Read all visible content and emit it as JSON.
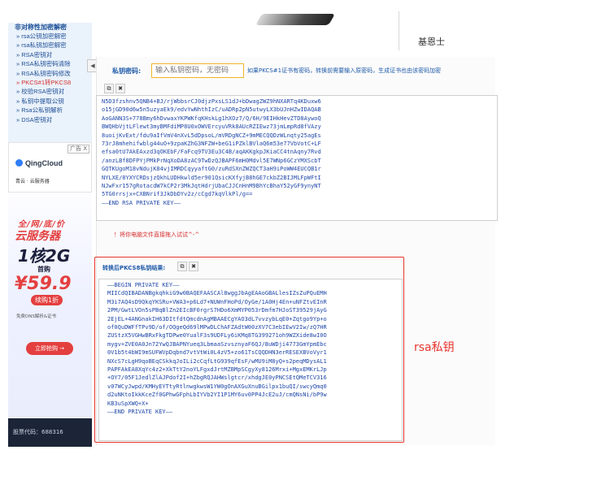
{
  "sidebar": {
    "title": "非对称性加密解密",
    "items": [
      {
        "label": "» rsa公钥加密解密",
        "active": false
      },
      {
        "label": "» rsa私钥加密解密",
        "active": false
      },
      {
        "label": "» RSA密钥对",
        "active": false
      },
      {
        "label": "» RSA私钥密码清除",
        "active": false
      },
      {
        "label": "» RSA私钥密码修改",
        "active": false
      },
      {
        "label": "» PKCS#1转PKCS8",
        "active": true
      },
      {
        "label": "» 校验RSA密钥对",
        "active": false
      },
      {
        "label": "» 私钥中提取公钥",
        "active": false
      },
      {
        "label": "» Rsa公私钥解析",
        "active": false
      },
      {
        "label": "» DSA密钥对",
        "active": false
      }
    ],
    "collapse_label": "◀"
  },
  "ad": {
    "close_label": "广告 X",
    "logo": "QingCloud",
    "sub": "青云 · 云服务器",
    "line1": "全/网/底/价",
    "line2": "云服务器",
    "line3": "1核2G",
    "line4": "首购",
    "line5": "¥59.9",
    "line6": "续购1折",
    "line7": "免费DNS解析&证书",
    "cta": "立即抢购 →",
    "stock": "股票代码：688316"
  },
  "top": {
    "right_text": "基恩士"
  },
  "form": {
    "password_label": "私钥密码:",
    "password_placeholder": "输入私钥密码，无密码",
    "password_note": "如果PKCS#1证书有密码，转换前需要输入原密码，生成证书也由该密码加密",
    "copy_icon": "⧉",
    "clear_icon": "✖",
    "input_key": "N5D3fzshnv5QNB4+BJ/rjWbbsrCJ0djzPxsLS1dJ+bDwagZWZ9hNXARTq4KDuxw6\no15jGD90d6w5n5uzyaEk9/edvYwNhthIzC/uADRp2pN5utwyLX3bUJnHZwIDAQAB\nAoGANN3S+778Bmy6hDvwaxYKPWKfqKHskLg1hXOz7/Q/6H/9EIHkHevZTD8AywoQ\nBWQHbVjtLFlewt3myBMFdiMP8U0xOWVErcyuVRk8AUcRZIEwz73jmLmpRd8fVAzy\n8uoijKvExt/fdu9aIfVmV4nXvL5dDpsoL/mVRDgNCZ+9mMECQQDzWLnqty25agEs\n73rJ8mhehifwblg44uO+9zpaKZhG3NFZW+beG1iPZklBVlaQ6m53e77VbVotC+LF\nefsa0tU7AkEAxzd3qOKEbF/FaFcq9TV3Eu3C4B/aqAKKgkpJKiaCC4tnAqny7Rvd\n/anzLBf8DFPYjPMkPrNqXoDA8zAC9TwDzQJBAPF6mH0Mdvl5E7WNp6GCzYMXScbT\nGQTKUgoM18vNdujK84vjIMRDCqyyaftG0/zuRdSXnZWZQCT3aH9iPoWW4EUCQB1r\nNYLXE/8YXYCRDsjzQkhLUDHkwld5er901QsicKXfyjB8hGE7ckbZ2BIJMLFpWFtI\nNJwFxr157gRotacdW7kCP2r3MkJqtHdrjUbaCJJCnHnM9BhYcBhaY52yGF9ynyNT\n5TG0rrsjx+CXBNrif3JkDbDYv2z/cCgd7kqVlkPl/g==\n——END RSA PRIVATE KEY——",
    "drag_hint": "！将你电脑文件直接拖入试试^-^",
    "output_label": "转换后PKCS8私钥结果:",
    "output_key": "——BEGIN PRIVATE KEY——\nMIICdQIBADANBgkqhkiG9w0BAQEFAASCAl8wggJbAgEAAoGBALlesIZsZuPQuEMH\nM3i7AQ4sD9QkqYKSRu+VWA3+p6Ld7+NUWnFHoPd/OyGe/1A0Hj4En+uNFZtvEInR\n2PM/GwtLVOn5sPBqBlZn2EIcBF0rgrS7HDo6XmMYP053rDmfm7HJoST39529jAyG\n2EjEL+4ANGnakIH63DItfdtQmcdnAgMBAAECgYAO3dL7vvzybLqE0+Zqtgo9Yp+o\nof0QuDWFfTPv9D/of/OQgeQd69lMPwDLChAFZAdtW00zXV7C3ebIEwV2Iw/zQ7HR\nZUStzX5VGHwBRxFkgTDPwe0YualF3s9UDFLy6iKMq8TG399271oh9WZXide8wI0O\nmygv+ZVE0A0Jn72YwQJBAPNYueq3LbmaaSzvsznyaF6QJ/BuWDji4773GmYpmEbc\n0V1b5t4bWI9mSUFWVpDqbnd7vtVtWi0L4zV5+zo61TsCQQDHN3erRESEXBVoVyr1\nNXcS7cLgH9qoBEqCSkkqJoILi2cCqfLtG939qfEsF/wMU9iM8yQ+s2peqMDysAL1\nPAPFAkEA8XqYc4z2+XkTtY2noYLFgxdJrtMZBMpSCgyXy8126Mrxi+MgxEMKrLJp\n+OY7/05F1JedlZlAJPdof2I+hZbgRQJAHWslgtcr/xhdgJE0yPNCSEtQMeTCV316\nv07WCyJwpd/KMHyEYTtyRtlnwgkwsW1YW0gOnAXGuXnuBGilpx1buQI/swcyQmq0\nd2uNKtoIkkKceZf0GPhwGFphLbIYVb2YI1P1MY6uv0PP4JcE2uJ/cmQNsNi/bP9w\nKB3uSpXWQ+X+\n——END PRIVATE KEY——"
  },
  "annotation": "rsa私钥"
}
